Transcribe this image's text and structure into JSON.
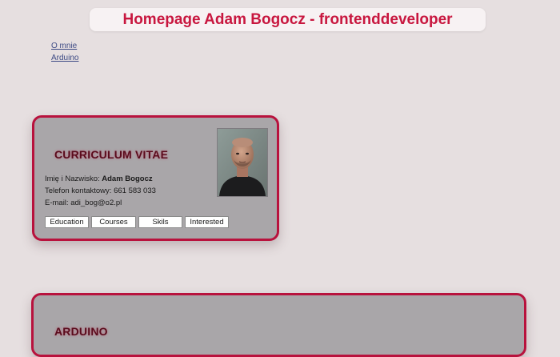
{
  "header": {
    "title": "Homepage Adam Bogocz - frontenddeveloper"
  },
  "nav": {
    "items": [
      {
        "label": "O mnie"
      },
      {
        "label": "Arduino"
      }
    ]
  },
  "cv": {
    "title": "CURRICULUM VITAE",
    "name_label": "Imię i Nazwisko: ",
    "name_value": "Adam Bogocz",
    "phone_label": "Telefon kontaktowy: ",
    "phone_value": "661 583 033",
    "email_label": "E-mail: ",
    "email_value": "adi_bog@o2.pl",
    "photo_alt": "portrait photo",
    "buttons": [
      {
        "label": "Education"
      },
      {
        "label": "Courses"
      },
      {
        "label": "Skils"
      },
      {
        "label": "Interested"
      }
    ]
  },
  "arduino": {
    "title": "ARDUINO"
  },
  "colors": {
    "accent": "#c8173f",
    "card_border": "#b8123d",
    "card_bg": "#a9a6a9",
    "page_bg": "#e6dfe0"
  }
}
